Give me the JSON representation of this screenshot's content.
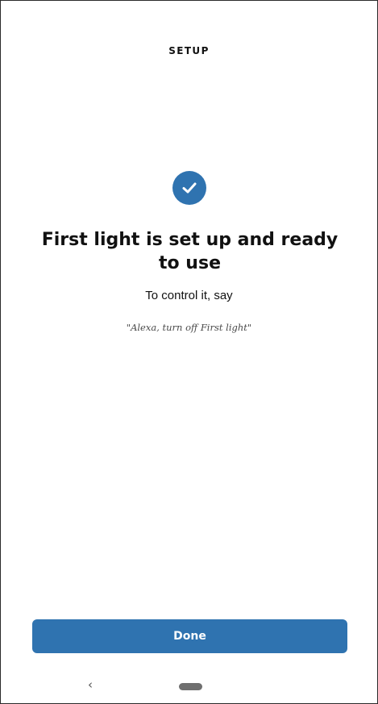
{
  "header": {
    "title": "SETUP"
  },
  "status": {
    "icon": "checkmark-icon",
    "accent_color": "#2f73b0"
  },
  "main": {
    "title": "First light is set up and ready to use",
    "instruction": "To control it, say",
    "voice_command": "\"Alexa, turn off First light\""
  },
  "actions": {
    "done_label": "Done"
  },
  "navigation": {
    "back_glyph": "‹",
    "back_icon": "back-chevron-icon",
    "home_icon": "home-pill-icon"
  }
}
